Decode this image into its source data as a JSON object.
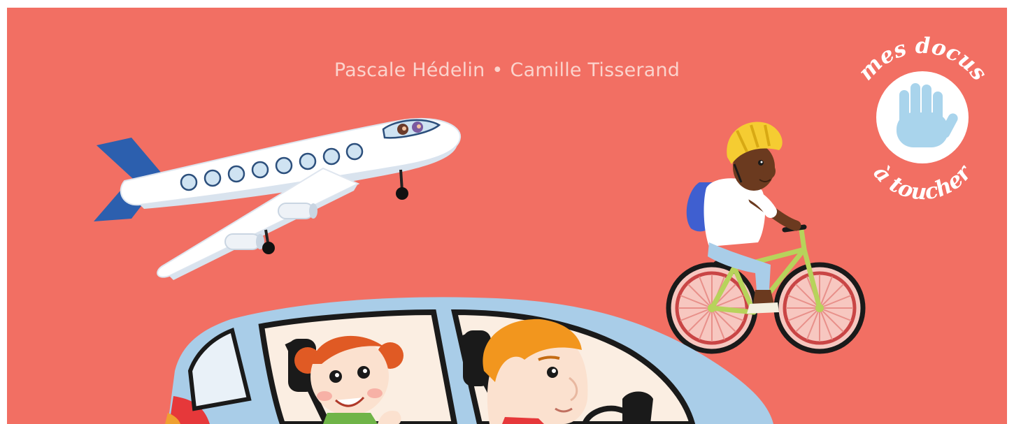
{
  "cover": {
    "authors": {
      "author1": "Pascale Hédelin",
      "separator": "•",
      "author2": "Camille Tisserand"
    },
    "badge": {
      "top_text": "mes docus",
      "bottom_text": "à toucher",
      "icon": "hand-icon"
    },
    "illustrations": [
      "airplane",
      "child-on-bicycle",
      "car-with-passengers"
    ],
    "colors": {
      "background": "#f26f63",
      "author_text": "#fbd3cc",
      "badge": "#ffffff",
      "hand": "#a9d4ec",
      "car": "#a9cde8",
      "helmet": "#f5cc32",
      "bicycle": "#b7d35b"
    }
  }
}
